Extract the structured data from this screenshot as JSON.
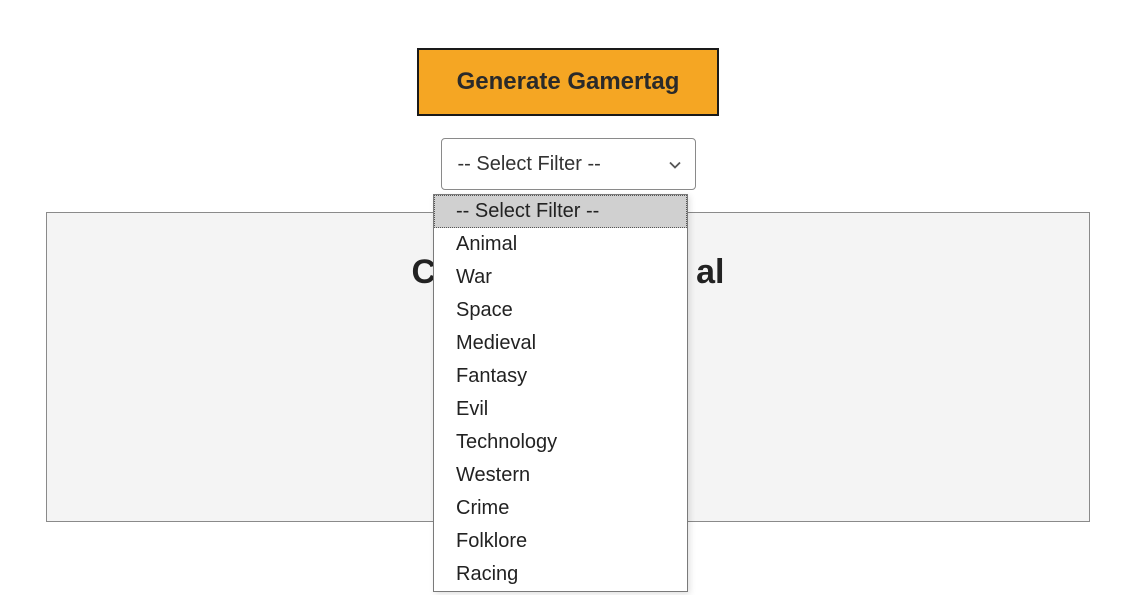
{
  "button": {
    "label": "Generate Gamertag"
  },
  "filter": {
    "placeholder": "-- Select Filter --",
    "selected": "-- Select Filter --",
    "options": [
      "-- Select Filter --",
      "Animal",
      "War",
      "Space",
      "Medieval",
      "Fantasy",
      "Evil",
      "Technology",
      "Western",
      "Crime",
      "Folklore",
      "Racing"
    ]
  },
  "result": {
    "title_left": "C",
    "title_right": "al"
  }
}
